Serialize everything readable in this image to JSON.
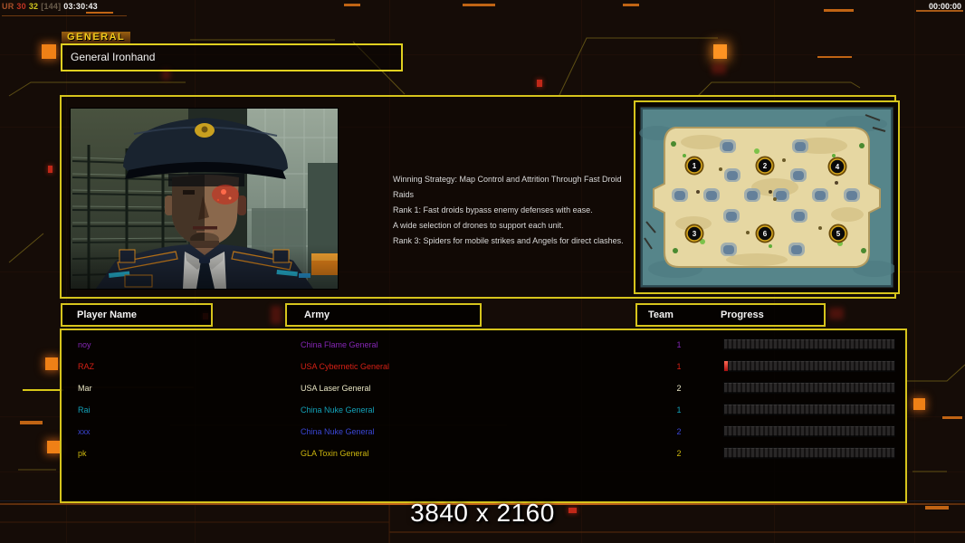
{
  "hud": {
    "net_label": "UR",
    "fps": "30",
    "counter": "32",
    "frame": "[144]",
    "session_time": "03:30:43",
    "game_clock": "00:00:00"
  },
  "general_panel": {
    "tab_label": "GENERAL",
    "general_name": "General Ironhand",
    "strategy_lines": [
      "Winning Strategy: Map Control and Attrition Through Fast Droid Raids",
      "Rank 1: Fast droids bypass enemy defenses with ease.",
      "A wide selection of drones to support each unit.",
      "Rank 3: Spiders for mobile strikes and Angels for direct clashes."
    ]
  },
  "map_preview": {
    "start_positions": [
      {
        "label": "1"
      },
      {
        "label": "2"
      },
      {
        "label": "4"
      },
      {
        "label": "3"
      },
      {
        "label": "6"
      },
      {
        "label": "5"
      }
    ]
  },
  "lobby_table": {
    "headers": {
      "player_name": "Player Name",
      "army": "Army",
      "team": "Team",
      "progress": "Progress"
    },
    "players": [
      {
        "name": "noy",
        "army": "China Flame General",
        "team": "1",
        "color": "#8426b4",
        "progress_pct": 0
      },
      {
        "name": "RAZ",
        "army": "USA Cybernetic General",
        "team": "1",
        "color": "#d42015",
        "progress_pct": 2
      },
      {
        "name": "Mar",
        "army": "USA Laser General",
        "team": "2",
        "color": "#e9e6c4",
        "progress_pct": 0
      },
      {
        "name": "Rai",
        "army": "China Nuke General",
        "team": "1",
        "color": "#13a2b8",
        "progress_pct": 0
      },
      {
        "name": "xxx",
        "army": "China Nuke General",
        "team": "2",
        "color": "#3a46d4",
        "progress_pct": 0
      },
      {
        "name": "pk",
        "army": "GLA Toxin General",
        "team": "2",
        "color": "#cdb70e",
        "progress_pct": 0
      }
    ]
  },
  "footer": {
    "resolution_label": "3840 x 2160"
  },
  "theme": {
    "accent_yellow": "#d6c41c",
    "accent_orange": "#e87c14",
    "progress_fill_red": "#d43020"
  }
}
